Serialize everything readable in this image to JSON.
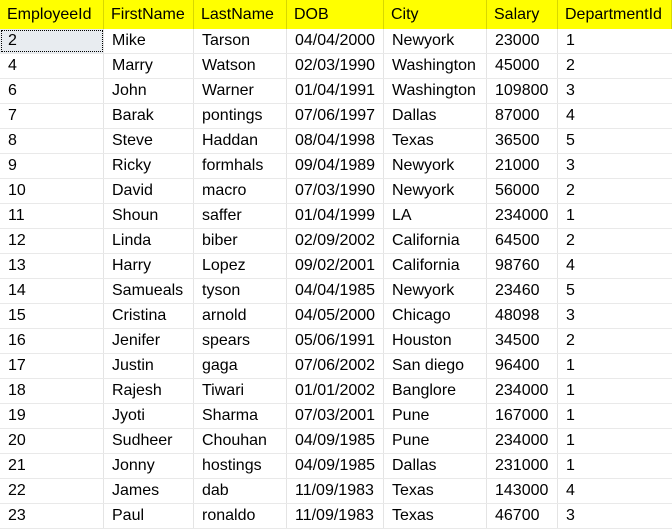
{
  "columns": [
    "EmployeeId",
    "FirstName",
    "LastName",
    "DOB",
    "City",
    "Salary",
    "DepartmentId"
  ],
  "rows": [
    [
      "2",
      "Mike",
      "Tarson",
      "04/04/2000",
      "Newyork",
      "23000",
      "1"
    ],
    [
      "4",
      "Marry",
      "Watson",
      "02/03/1990",
      "Washington",
      "45000",
      "2"
    ],
    [
      "6",
      "John",
      "Warner",
      "01/04/1991",
      "Washington",
      "109800",
      "3"
    ],
    [
      "7",
      "Barak",
      "pontings",
      "07/06/1997",
      "Dallas",
      "87000",
      "4"
    ],
    [
      "8",
      "Steve",
      "Haddan",
      "08/04/1998",
      "Texas",
      "36500",
      "5"
    ],
    [
      "9",
      "Ricky",
      "formhals",
      "09/04/1989",
      "Newyork",
      "21000",
      "3"
    ],
    [
      "10",
      "David",
      "macro",
      "07/03/1990",
      "Newyork",
      "56000",
      "2"
    ],
    [
      "11",
      "Shoun",
      "saffer",
      "01/04/1999",
      "LA",
      "234000",
      "1"
    ],
    [
      "12",
      "Linda",
      "biber",
      "02/09/2002",
      "California",
      "64500",
      "2"
    ],
    [
      "13",
      "Harry",
      "Lopez",
      "09/02/2001",
      "California",
      "98760",
      "4"
    ],
    [
      "14",
      "Samueals",
      "tyson",
      "04/04/1985",
      "Newyork",
      "23460",
      "5"
    ],
    [
      "15",
      "Cristina",
      "arnold",
      "04/05/2000",
      "Chicago",
      "48098",
      "3"
    ],
    [
      "16",
      "Jenifer",
      "spears",
      "05/06/1991",
      "Houston",
      "34500",
      "2"
    ],
    [
      "17",
      "Justin",
      "gaga",
      "07/06/2002",
      "San diego",
      "96400",
      "1"
    ],
    [
      "18",
      "Rajesh",
      "Tiwari",
      "01/01/2002",
      "Banglore",
      "234000",
      "1"
    ],
    [
      "19",
      "Jyoti",
      "Sharma",
      "07/03/2001",
      "Pune",
      "167000",
      "1"
    ],
    [
      "20",
      "Sudheer",
      "Chouhan",
      "04/09/1985",
      "Pune",
      "234000",
      "1"
    ],
    [
      "21",
      "Jonny",
      "hostings",
      "04/09/1985",
      "Dallas",
      "231000",
      "1"
    ],
    [
      "22",
      "James",
      "dab",
      "11/09/1983",
      "Texas",
      "143000",
      "4"
    ],
    [
      "23",
      "Paul",
      "ronaldo",
      "11/09/1983",
      "Texas",
      "46700",
      "3"
    ]
  ],
  "colors": {
    "header_highlight": "#ffff00",
    "selected_cell": "#e8ecf0"
  }
}
